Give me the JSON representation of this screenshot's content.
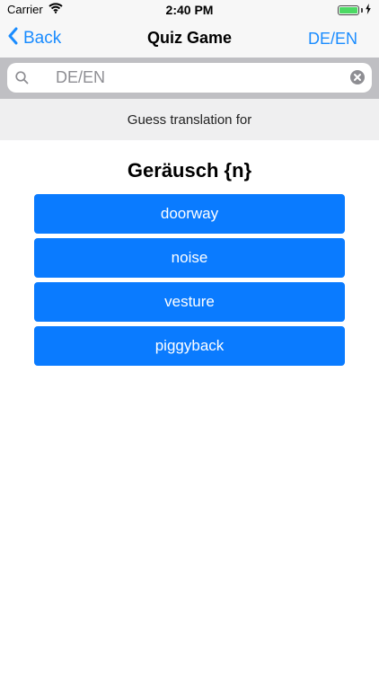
{
  "status_bar": {
    "carrier": "Carrier",
    "time": "2:40 PM",
    "icons": {
      "wifi": "wifi-icon",
      "battery": "battery-icon",
      "charging": "charging-bolt-icon"
    }
  },
  "nav": {
    "back_label": "Back",
    "title": "Quiz Game",
    "right_label": "DE/EN",
    "accent_color": "#1a8cff"
  },
  "search": {
    "value": "DE/EN",
    "icon": "search-icon",
    "clear_icon": "clear-icon"
  },
  "prompt": {
    "text": "Guess translation for"
  },
  "question": {
    "word": "Geräusch {n}"
  },
  "answers": [
    {
      "label": "doorway"
    },
    {
      "label": "noise"
    },
    {
      "label": "vesture"
    },
    {
      "label": "piggyback"
    }
  ],
  "colors": {
    "button_bg": "#0a7bff",
    "button_text": "#ffffff"
  }
}
